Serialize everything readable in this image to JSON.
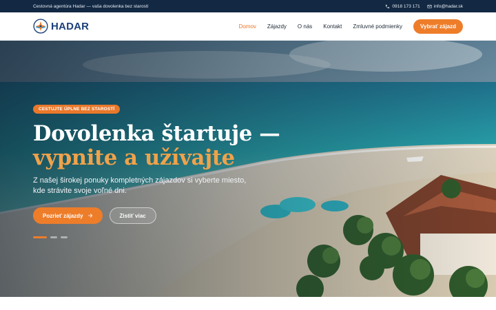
{
  "topbar": {
    "tagline": "Cestovná agentúra Hadar — vaša dovolenka bez starostí",
    "phone": "0918 173 171",
    "email": "info@hadar.sk"
  },
  "header": {
    "brand": "HADAR",
    "nav": [
      {
        "label": "Domov",
        "active": true
      },
      {
        "label": "Zájazdy",
        "active": false
      },
      {
        "label": "O nás",
        "active": false
      },
      {
        "label": "Kontakt",
        "active": false
      },
      {
        "label": "Zmluvné podmienky",
        "active": false
      }
    ],
    "cta": "Vybrať zájazd"
  },
  "hero": {
    "badge": "CESTUJTE ÚPLNE BEZ STAROSTÍ",
    "headline_line1": "Dovolenka štartuje —",
    "headline_line2": "vypnite a užívajte",
    "subtext": "Z našej širokej ponuky kompletných zájazdov si vyberte miesto, kde strávite svoje voľné dni.",
    "primary_button": "Pozrieť zájazdy",
    "secondary_button": "Zistiť viac",
    "slides": 3,
    "active_slide": 1
  },
  "colors": {
    "accent": "#ee7d2a",
    "brand_blue": "#1b3f7a",
    "topbar": "#132943"
  }
}
